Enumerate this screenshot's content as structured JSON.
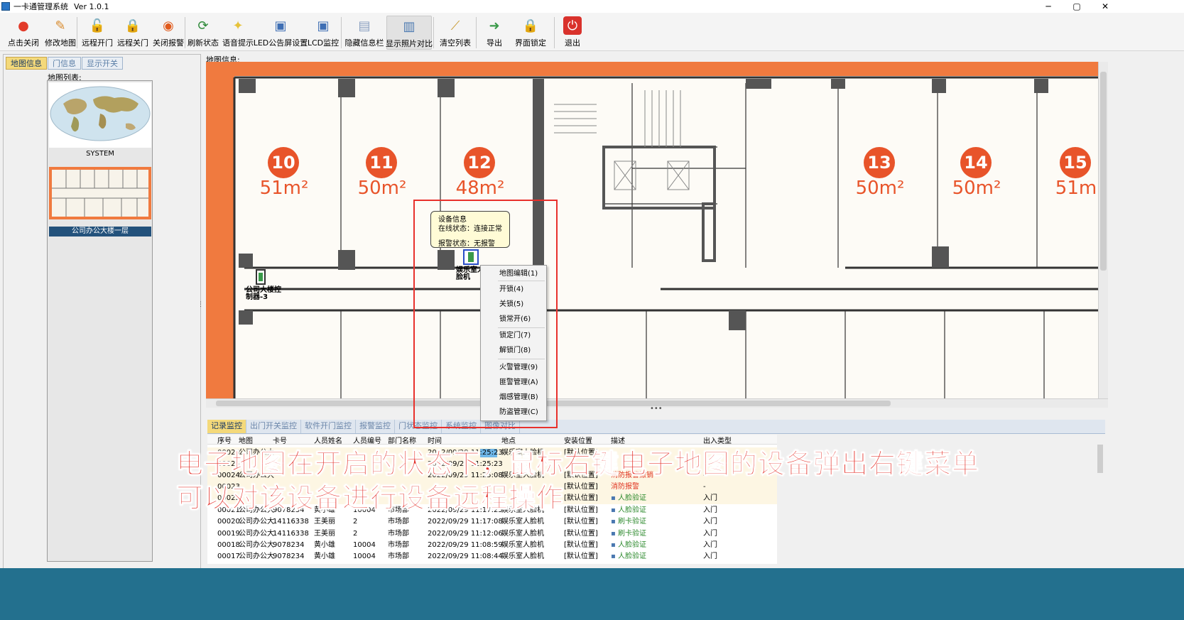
{
  "window": {
    "title": "一卡通管理系统",
    "version": "Ver 1.0.1",
    "min": "─",
    "max": "▢",
    "close": "✕"
  },
  "toolbar": [
    {
      "id": "tb-close-click",
      "label": "点击关闭",
      "icon": "red-light-icon",
      "glyph": "●",
      "color": "#e23b2a"
    },
    {
      "id": "tb-edit-map",
      "label": "修改地图",
      "icon": "map-edit-icon",
      "glyph": "✎",
      "color": "#d88a2c"
    },
    {
      "id": "tb-remote-open",
      "label": "远程开门",
      "icon": "unlock-icon",
      "glyph": "🔓",
      "color": "#e3a21a"
    },
    {
      "id": "tb-remote-close",
      "label": "远程关门",
      "icon": "lock-icon",
      "glyph": "🔒",
      "color": "#e3a21a"
    },
    {
      "id": "tb-close-alarm",
      "label": "关闭报警",
      "icon": "alarm-off-icon",
      "glyph": "◉",
      "color": "#e05a1c"
    },
    {
      "id": "tb-refresh",
      "label": "刷新状态",
      "icon": "refresh-icon",
      "glyph": "⟳",
      "color": "#2f8a3a"
    },
    {
      "id": "tb-voice",
      "label": "语音提示",
      "icon": "bulb-icon",
      "glyph": "✦",
      "color": "#e6c23a"
    },
    {
      "id": "tb-led",
      "label": "LED公告屏设置",
      "icon": "led-screen-icon",
      "glyph": "▣",
      "color": "#3f6fb4"
    },
    {
      "id": "tb-lcd",
      "label": "LCD监控",
      "icon": "lcd-monitor-icon",
      "glyph": "▣",
      "color": "#3f6fb4"
    },
    {
      "id": "tb-hide-info",
      "label": "隐藏信息栏",
      "icon": "hide-panel-icon",
      "glyph": "▤",
      "color": "#8aa0c0"
    },
    {
      "id": "tb-photo",
      "label": "显示照片对比",
      "icon": "photo-compare-icon",
      "glyph": "▥",
      "color": "#4a78b0"
    },
    {
      "id": "tb-clear",
      "label": "清空列表",
      "icon": "broom-icon",
      "glyph": "⟋",
      "color": "#c79a32"
    },
    {
      "id": "tb-export",
      "label": "导出",
      "icon": "export-icon",
      "glyph": "➜",
      "color": "#3b9a4a"
    },
    {
      "id": "tb-lockui",
      "label": "界面锁定",
      "icon": "padlock-icon",
      "glyph": "🔒",
      "color": "#e3a21a"
    },
    {
      "id": "tb-exit",
      "label": "退出",
      "icon": "power-icon",
      "glyph": "⏻",
      "color": "#ffffff"
    }
  ],
  "left": {
    "tabs": [
      "地图信息",
      "门信息",
      "显示开关"
    ],
    "map_list_label": "地图列表:",
    "maps": [
      "SYSTEM",
      "公司办公大楼一层"
    ]
  },
  "main": {
    "map_info_label": "地图信息:"
  },
  "rooms": [
    {
      "num": "10",
      "area": "51m²"
    },
    {
      "num": "11",
      "area": "50m²"
    },
    {
      "num": "12",
      "area": "48m²"
    },
    {
      "num": "13",
      "area": "50m²"
    },
    {
      "num": "14",
      "area": "50m²"
    },
    {
      "num": "15",
      "area": "51m"
    }
  ],
  "devices": {
    "left": "公司大楼控制器-3",
    "center": "娱乐室人脸机"
  },
  "tooltip": {
    "title": "设备信息",
    "online": "在线状态：连接正常",
    "alarm": "报警状态：无报警"
  },
  "context_menu": [
    {
      "label": "地图编辑(1)"
    },
    {
      "label": "开锁(4)"
    },
    {
      "label": "关锁(5)"
    },
    {
      "label": "锁常开(6)"
    },
    {
      "label": "锁定门(7)"
    },
    {
      "label": "解锁门(8)"
    },
    {
      "label": "火警管理(9)"
    },
    {
      "label": "匪警管理(A)"
    },
    {
      "label": "烟感管理(B)"
    },
    {
      "label": "防盗管理(C)"
    }
  ],
  "bottom": {
    "tabs": [
      "记录监控",
      "出门开关监控",
      "软件开门监控",
      "报警监控",
      "门状态监控",
      "系统监控",
      "图像对比"
    ],
    "columns": [
      "序号",
      "地图",
      "卡号",
      "人员姓名",
      "人员编号",
      "部门名称",
      "时间",
      "地点",
      "安装位置",
      "描述",
      "出入类型"
    ],
    "rows": [
      {
        "seq": "00025",
        "map": "公司办公大",
        "card": "",
        "name": "",
        "no": "",
        "dept": "",
        "time": "2022/09/29 11:25:23",
        "place": "娱乐室人脸机",
        "pos": "[默认位置]",
        "desc": "",
        "io": ""
      },
      {
        "seq": "00025",
        "map": "",
        "card": "",
        "name": "",
        "no": "",
        "dept": "",
        "time": "2022/09/29 11:25:23",
        "place": "",
        "pos": "",
        "desc": "",
        "io": ""
      },
      {
        "seq": "00024",
        "map": "公司办公大",
        "card": "",
        "name": "",
        "no": "",
        "dept": "",
        "time": "2022/09/29 11:25:08",
        "place": "娱乐室人脸机",
        "pos": "[默认位置]",
        "desc": "消防报警撤销",
        "io": "-"
      },
      {
        "seq": "00023",
        "map": "",
        "card": "",
        "name": "",
        "no": "",
        "dept": "",
        "time": "",
        "place": "",
        "pos": "[默认位置]",
        "desc": "消防报警",
        "io": "-"
      },
      {
        "seq": "00022",
        "map": "",
        "card": "",
        "name": "",
        "no": "",
        "dept": "",
        "time": "",
        "place": "",
        "pos": "[默认位置]",
        "desc": "人脸验证",
        "io": "入门"
      },
      {
        "seq": "00021",
        "map": "公司办公大",
        "card": "9078234",
        "name": "黄小雄",
        "no": "10004",
        "dept": "市场部",
        "time": "2022/09/29 11:17:25",
        "place": "娱乐室人脸机",
        "pos": "[默认位置]",
        "desc": "人脸验证",
        "io": "入门"
      },
      {
        "seq": "00020",
        "map": "公司办公大",
        "card": "14116338",
        "name": "王美丽",
        "no": "2",
        "dept": "市场部",
        "time": "2022/09/29 11:17:08",
        "place": "娱乐室人脸机",
        "pos": "[默认位置]",
        "desc": "刷卡验证",
        "io": "入门"
      },
      {
        "seq": "00019",
        "map": "公司办公大",
        "card": "14116338",
        "name": "王美丽",
        "no": "2",
        "dept": "市场部",
        "time": "2022/09/29 11:12:06",
        "place": "娱乐室人脸机",
        "pos": "[默认位置]",
        "desc": "刷卡验证",
        "io": "入门"
      },
      {
        "seq": "00018",
        "map": "公司办公大",
        "card": "9078234",
        "name": "黄小雄",
        "no": "10004",
        "dept": "市场部",
        "time": "2022/09/29 11:08:59",
        "place": "娱乐室人脸机",
        "pos": "[默认位置]",
        "desc": "人脸验证",
        "io": "入门"
      },
      {
        "seq": "00017",
        "map": "公司办公大",
        "card": "9078234",
        "name": "黄小雄",
        "no": "10004",
        "dept": "市场部",
        "time": "2022/09/29 11:08:44",
        "place": "娱乐室人脸机",
        "pos": "[默认位置]",
        "desc": "人脸验证",
        "io": "入门"
      }
    ]
  },
  "caption": {
    "line1": "电子地图在开启的状态下，鼠标右键电子地图的设备弹出右键菜单",
    "line2": "可以对该设备进行设备远程操作"
  },
  "colors": {
    "orange": "#f07a3f",
    "room_num": "#e8542a",
    "alarm_red": "#e0331f",
    "verify_green": "#2d8a2d",
    "select_blue": "#6fb7e8"
  }
}
